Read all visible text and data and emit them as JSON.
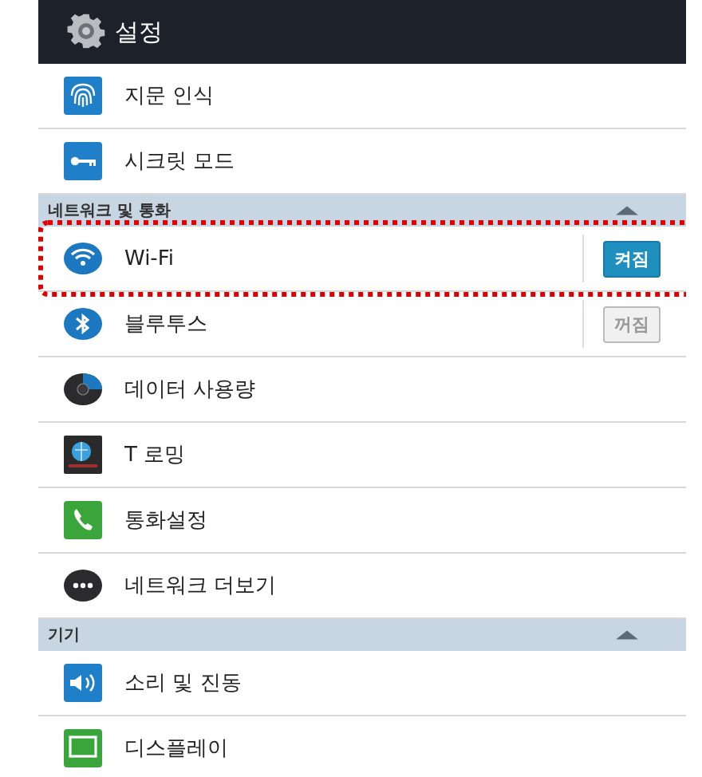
{
  "header": {
    "title": "설정"
  },
  "sections": [
    {
      "items": [
        {
          "label": "지문 인식",
          "kind": "plain",
          "highlighted": false
        },
        {
          "label": "시크릿 모드",
          "kind": "plain",
          "highlighted": false
        }
      ]
    },
    {
      "title": "네트워크 및 통화",
      "collapsed": false,
      "items": [
        {
          "label": "Wi-Fi",
          "kind": "toggle",
          "toggle": {
            "label": "켜짐",
            "on": true
          },
          "highlighted": true
        },
        {
          "label": "블루투스",
          "kind": "toggle",
          "toggle": {
            "label": "꺼짐",
            "on": false
          },
          "highlighted": false
        },
        {
          "label": "데이터 사용량",
          "kind": "plain",
          "highlighted": false
        },
        {
          "label": "T 로밍",
          "kind": "plain",
          "highlighted": false
        },
        {
          "label": "통화설정",
          "kind": "plain",
          "highlighted": false
        },
        {
          "label": "네트워크 더보기",
          "kind": "plain",
          "highlighted": false
        }
      ]
    },
    {
      "title": "기기",
      "collapsed": false,
      "items": [
        {
          "label": "소리 및 진동",
          "kind": "plain",
          "highlighted": false
        },
        {
          "label": "디스플레이",
          "kind": "plain",
          "highlighted": false
        }
      ]
    }
  ]
}
